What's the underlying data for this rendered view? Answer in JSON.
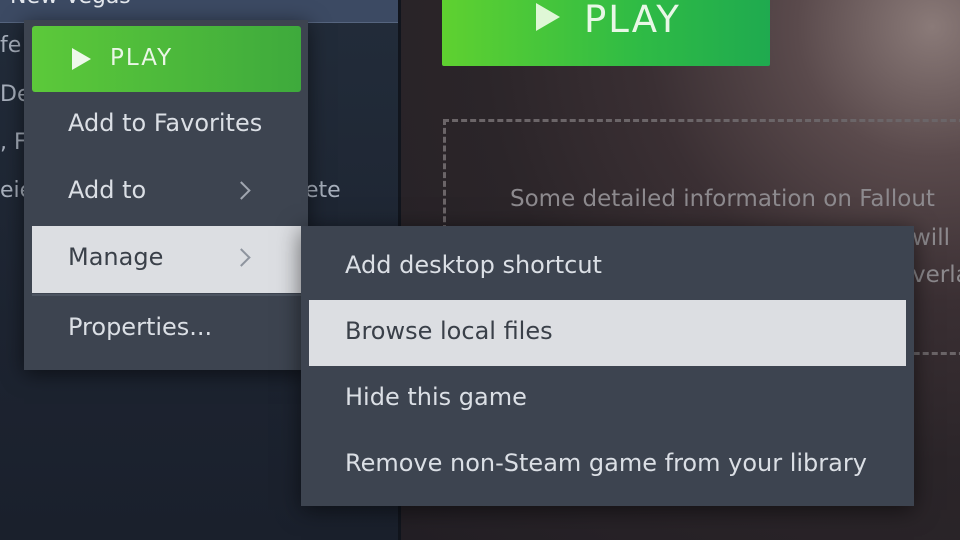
{
  "library": {
    "selected_game": "New Vegas",
    "fragments": [
      "fe",
      "De",
      ", F",
      "eie",
      "ete"
    ]
  },
  "hero": {
    "play_label": "PLAY",
    "info_text": "Some detailed information on Fallout",
    "info_fragment_1": "will",
    "info_fragment_2": "verla"
  },
  "context_menu": {
    "play_label": "PLAY",
    "items": [
      {
        "label": "Add to Favorites"
      },
      {
        "label": "Add to"
      },
      {
        "label": "Manage"
      },
      {
        "label": "Properties..."
      }
    ]
  },
  "manage_submenu": {
    "items": [
      {
        "label": "Add desktop shortcut"
      },
      {
        "label": "Browse local files"
      },
      {
        "label": "Hide this game"
      },
      {
        "label": "Remove non-Steam game from your library"
      }
    ]
  },
  "colors": {
    "play_green": "#5cc93a",
    "menu_bg": "#3d4450",
    "highlight_bg": "#dcdee2"
  }
}
